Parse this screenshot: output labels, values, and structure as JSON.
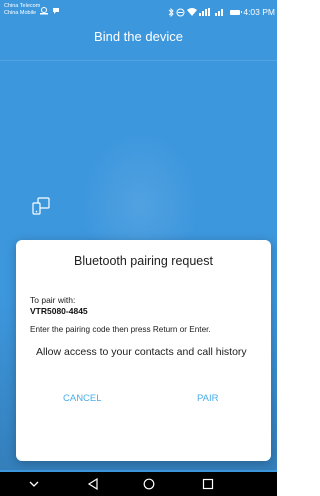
{
  "status_bar": {
    "carrier_line1": "China Telecom",
    "carrier_line2": "China Mobile",
    "left_icons": "◙ ◉",
    "time": "4:03 PM",
    "right_icons_text": "✱ ◔ ☲ ≡≡❙ ≡❙",
    "text_color": "#ffffff"
  },
  "app": {
    "title": "Bind the device",
    "background_color": "#3d97dd"
  },
  "dialog": {
    "title": "Bluetooth pairing request",
    "pair_with_label": "To pair with:",
    "device_name": "VTR5080-4845",
    "instruction": "Enter the pairing code then press Return or Enter.",
    "allow_access": "Allow access to your contacts and call history",
    "cancel_label": "CANCEL",
    "pair_label": "PAIR",
    "button_color": "#4aaee8"
  },
  "nav_bar": {
    "icons": [
      "chevron-down-icon",
      "back-icon",
      "home-icon",
      "recents-icon"
    ]
  }
}
